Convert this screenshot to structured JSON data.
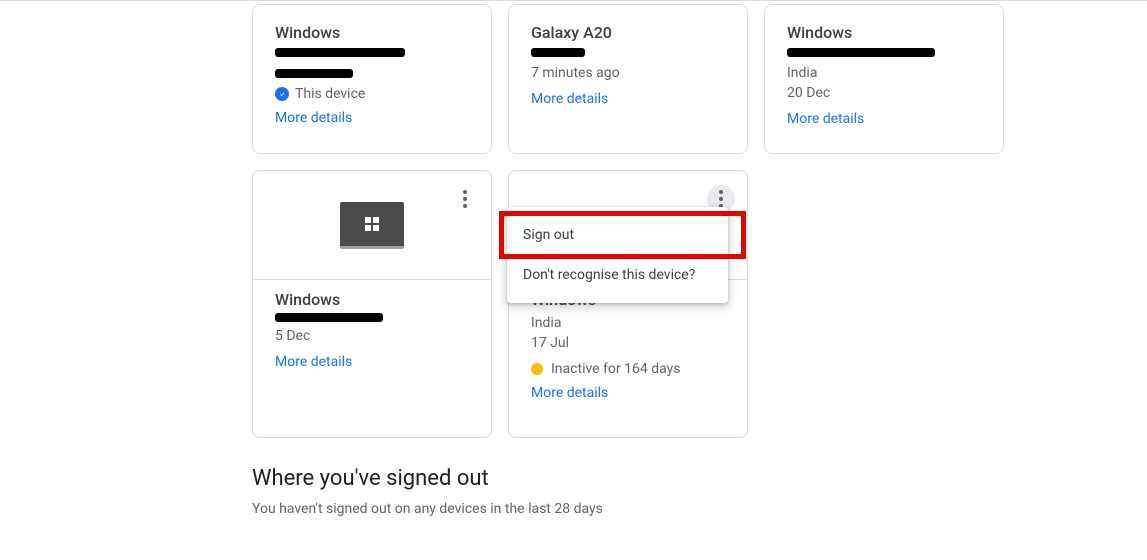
{
  "more_details": "More details",
  "this_device_label": "This device",
  "cards": {
    "r1c1": {
      "title": "Windows"
    },
    "r1c2": {
      "title": "Galaxy A20",
      "time": "7 minutes ago"
    },
    "r1c3": {
      "title": "Windows",
      "location": "India",
      "time": "20 Dec"
    },
    "r2c1": {
      "title": "Windows",
      "time": "5 Dec"
    },
    "r2c2": {
      "title": "Windows",
      "location": "India",
      "time": "17 Jul",
      "inactive": "Inactive for 164 days"
    }
  },
  "menu": {
    "sign_out": "Sign out",
    "dont_recognise": "Don't recognise this device?"
  },
  "signed_out": {
    "heading": "Where you've signed out",
    "text": "You haven't signed out on any devices in the last 28 days"
  }
}
